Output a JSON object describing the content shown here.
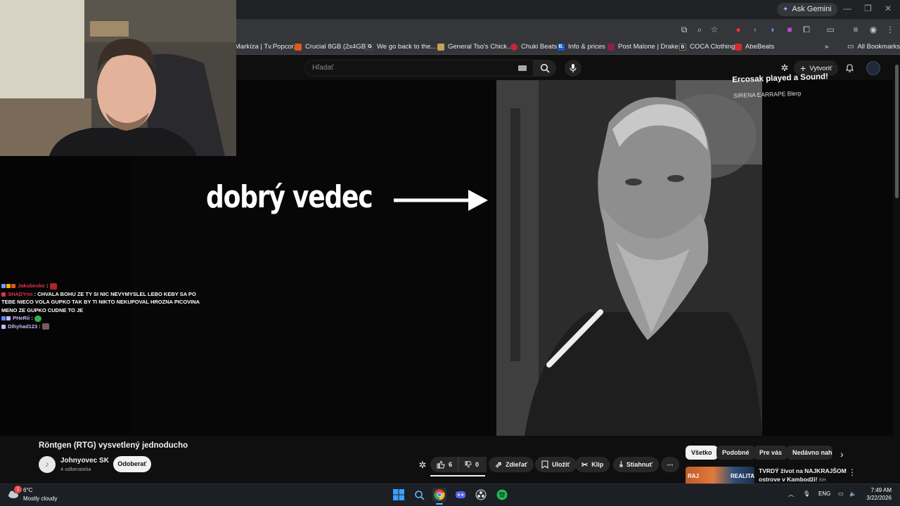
{
  "browser": {
    "ask_gemini": "Ask Gemini",
    "bookmarks": [
      {
        "label": "Markíza | Tv.Popcor...",
        "color": "#c13b2c"
      },
      {
        "label": "Crucial 8GB (2x4GB)...",
        "color": "#e05a1c"
      },
      {
        "label": "We go back to the...",
        "color": "#3c4043",
        "glyph": "G"
      },
      {
        "label": "General Tso's Chick...",
        "color": "#c8a05a"
      },
      {
        "label": "Chuki Beats",
        "color": "#c0283a"
      },
      {
        "label": "Info & prices",
        "color": "#1a56c8",
        "glyph": "B."
      },
      {
        "label": "Post Malone | Drake...",
        "color": "#8a2050"
      },
      {
        "label": "COCA Clothing",
        "color": "#222222",
        "glyph": "B"
      },
      {
        "label": "AbeBeats",
        "color": "#d22a2a"
      }
    ],
    "all_bookmarks": "All Bookmarks",
    "more": "»"
  },
  "youtube": {
    "search_placeholder": "Hľadať",
    "create_label": "Vytvoriť"
  },
  "video": {
    "caption": "dobrý vedec"
  },
  "alert": {
    "title": "Ercosak played a Sound!",
    "subtitle": "SIRENA EARRAPE Blerp"
  },
  "chat": {
    "lines": [
      {
        "user": "Jakubesko",
        "user_color": "#e0334a",
        "message": ""
      },
      {
        "user": "SHADYnn",
        "user_color": "#e0334a",
        "message": "CHVALA BOHU ZE TY SI NIC NEVYMYSLEL LEBO KEBY SA PO TEBE NIECO VOLA GUPKO TAK BY TI NIKTO NEKUPOVAL HROZNA PICOVINA MENO ZE GUPKO CUDNE TO JE"
      },
      {
        "user": "PHeRii",
        "user_color": "#c9b8ff",
        "message": ""
      },
      {
        "user": "Dlhyhad123",
        "user_color": "#c9b8ff",
        "message": ""
      }
    ]
  },
  "below_video": {
    "title": "Röntgen (RTG) vysvetlený jednoducho",
    "channel_name": "Johnyovec SK",
    "subscribers": "4 odberatelia",
    "subscribe_label": "Odoberať",
    "likes": "6",
    "dislikes": "0",
    "share_label": "Zdieľať",
    "save_label": "Uložiť",
    "clip_label": "Klip",
    "download_label": "Stiahnuť",
    "more_label": "⋯"
  },
  "sidebar_chips": [
    "Všetko",
    "Podobné",
    "Pre vás",
    "Nedávno nahr..."
  ],
  "recommendation": {
    "title": "TVRDÝ život na NAJKRAJŠOM ostrove v Kambodži!",
    "badge": "KH",
    "thumb_left": "RAJ",
    "thumb_right": "REALITA"
  },
  "taskbar": {
    "temperature": "6°C",
    "weather": "Mostly cloudy",
    "notification_count": "1",
    "language": "ENG",
    "time": "7:49 AM",
    "date": "3/22/2026"
  }
}
